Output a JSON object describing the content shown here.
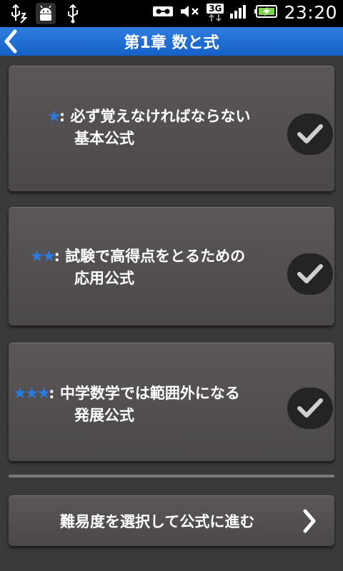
{
  "status_bar": {
    "time": "23:20",
    "network": "3G",
    "left_icons": [
      "usb-debug-icon",
      "android-icon",
      "usb-icon"
    ],
    "right_icons": [
      "voicemail-icon",
      "mute-icon",
      "network-3g-icon",
      "signal-icon",
      "battery-charging-icon"
    ]
  },
  "header": {
    "title": "第1章 数と式",
    "back_icon": "chevron-left-icon",
    "color": "#1e6fd6"
  },
  "cards": [
    {
      "stars": "★",
      "colon": ":",
      "line1": "必ず覚えなければならない",
      "line2": "基本公式",
      "checked_icon": "checkmark-icon"
    },
    {
      "stars": "★★",
      "colon": ":",
      "line1": "試験で高得点をとるための",
      "line2": "応用公式",
      "checked_icon": "checkmark-icon"
    },
    {
      "stars": "★★★",
      "colon": ":",
      "line1": "中学数学では範囲外になる",
      "line2": "発展公式",
      "checked_icon": "checkmark-icon"
    }
  ],
  "next_button": {
    "label": "難易度を選択して公式に進む",
    "icon": "chevron-right-icon"
  },
  "colors": {
    "accent": "#2a7be0",
    "background": "#3a3a3a",
    "card": "#555253"
  }
}
